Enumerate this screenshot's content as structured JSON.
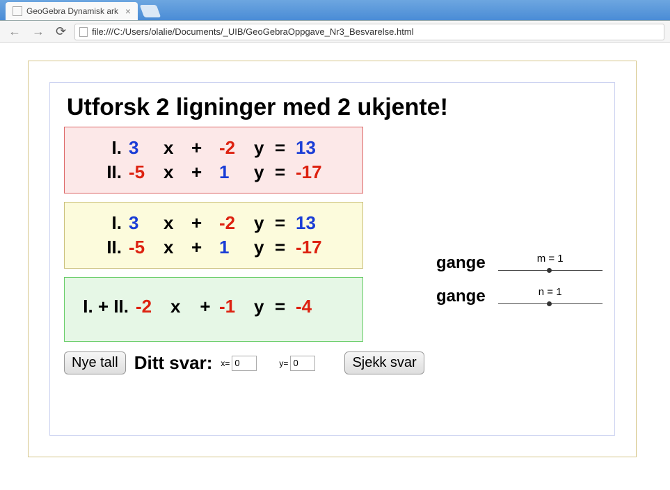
{
  "browser": {
    "tab_title": "GeoGebra Dynamisk ark",
    "url": "file:///C:/Users/olalie/Documents/_UIB/GeoGebraOppgave_Nr3_Besvarelse.html"
  },
  "title": "Utforsk 2 ligninger med 2 ukjente!",
  "eq": {
    "lab1": "I.",
    "lab2": "II.",
    "lab_sum": "I. + II.",
    "a11": "3",
    "a12": "-2",
    "b1": "13",
    "a21": "-5",
    "a22": "1",
    "b2": "-17",
    "s1": "-2",
    "s2": "-1",
    "sr": "-4",
    "x": "x",
    "y": "y",
    "plus": "+",
    "eq": "="
  },
  "side": {
    "gange": "gange",
    "m_label": "m = 1",
    "n_label": "n = 1"
  },
  "buttons": {
    "nye_tall": "Nye tall",
    "sjekk_svar": "Sjekk svar"
  },
  "answer": {
    "label": "Ditt svar:",
    "xlab": "x=",
    "ylab": "y=",
    "x_val": "0",
    "y_val": "0"
  }
}
